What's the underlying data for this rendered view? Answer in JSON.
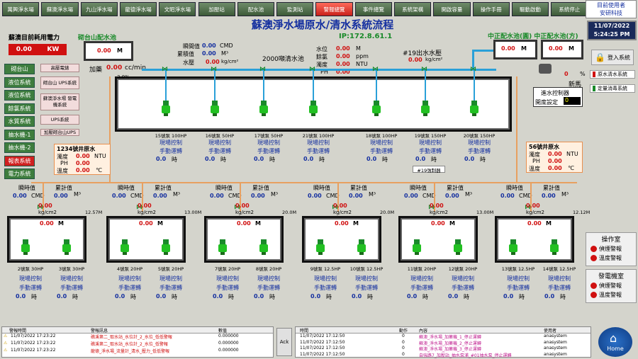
{
  "tabs": [
    {
      "label": "萬興淨水場",
      "active": false
    },
    {
      "label": "蘇澳淨水場",
      "active": false
    },
    {
      "label": "九山淨水場",
      "active": false
    },
    {
      "label": "龍德淨水場",
      "active": false
    },
    {
      "label": "文昭淨水場",
      "active": false
    },
    {
      "label": "加壓站",
      "active": false
    },
    {
      "label": "配水池",
      "active": false
    },
    {
      "label": "監測站",
      "active": false
    },
    {
      "label": "警報總覽",
      "active": true
    },
    {
      "label": "事件總覽",
      "active": false
    },
    {
      "label": "系統架構",
      "active": false
    },
    {
      "label": "開啟容量",
      "active": false
    },
    {
      "label": "操作手冊",
      "active": false
    },
    {
      "label": "驅動啟動",
      "active": false
    },
    {
      "label": "系統停止",
      "active": false
    }
  ],
  "user": {
    "label": "目前使用者",
    "name": "安研科技"
  },
  "clock": {
    "date": "11/07/2022",
    "time": "5:24:25 PM"
  },
  "title": "蘇澳淨水場原水/清水系統流程",
  "ip": "IP:172.8.61.1",
  "power": {
    "label": "蘇澳目前耗用電力",
    "value": "0.00",
    "unit": "KW"
  },
  "sidebar": [
    "砌台山",
    "液位系統",
    "液位系統",
    "餘氯系統",
    "水質系統",
    "抽水機-1",
    "抽水機-2",
    "報表系統",
    "電力系統"
  ],
  "pink_buttons": [
    "高壓電錶",
    "砌台山 UPS系統",
    "蘇澳淨水場 發電機系統",
    "UPS系統",
    "加壓砌台山UPS"
  ],
  "top_tank_label": "砌台山配水池",
  "top_tank_value": "0.00",
  "top_tank_unit": "M",
  "top_meter": {
    "run_label": "瞬間值",
    "total_label": "累積值",
    "press_label": "水壓",
    "run": "0.00",
    "run_unit": "CMD",
    "total": "0.00",
    "total_unit": "M³",
    "press": "0.00",
    "press_unit": "kg/cm²"
  },
  "dose": {
    "label": "加藥",
    "value": "0.00",
    "unit": "cc/min"
  },
  "pool": {
    "label": "2000噸清水池",
    "water_level_label": "水位",
    "chlorine_label": "餘氯",
    "turbidity_label": "濁度",
    "ph_label": "PH",
    "water_level": "0.00",
    "water_level_unit": "M",
    "chlorine": "0.00",
    "chlorine_unit": "ppm",
    "turbidity": "0.00",
    "turbidity_unit": "NTU",
    "ph": "0.00"
  },
  "outlet": {
    "label": "#19出水水壓",
    "value": "0.00",
    "unit": "kg/cm²"
  },
  "pct_label": "3.0%",
  "right_tanks": {
    "label": "中正配水池(圓) 中正配水池(方)",
    "left": "0.00",
    "right": "0.00",
    "unit": "M"
  },
  "water_control": {
    "label": "進水控制器",
    "set_label": "開度設定",
    "set_value": "0",
    "pct": "0",
    "unit": "%",
    "new_label": "新馬"
  },
  "right_buttons": [
    {
      "label": "登入系統"
    },
    {
      "label": "原水清水系統"
    },
    {
      "label": "定量消毒系統"
    }
  ],
  "top_pumps": [
    {
      "name": "15號泵 100HP",
      "ctl": "現場控制",
      "mode": "手動運轉",
      "val": "0.0",
      "unit": "時"
    },
    {
      "name": "16號泵 50HP",
      "ctl": "現場控制",
      "mode": "手動運轉",
      "val": "0.0",
      "unit": "時"
    },
    {
      "name": "17號泵 50HP",
      "ctl": "現場控制",
      "mode": "手動運轉",
      "val": "0.0",
      "unit": "時"
    },
    {
      "name": "21號泵 100HP",
      "ctl": "現場控制",
      "mode": "手動運轉",
      "val": "0.0",
      "unit": "時"
    },
    {
      "name": "18號泵 100HP",
      "ctl": "現場控制",
      "mode": "手動運轉",
      "val": "0.0",
      "unit": "時"
    },
    {
      "name": "19號泵 150HP",
      "ctl": "現場控制",
      "mode": "手動運轉",
      "val": "0.0",
      "unit": "時"
    },
    {
      "name": "20號泵 150HP",
      "ctl": "現場控制",
      "mode": "手動運轉",
      "val": "0.0",
      "unit": "時"
    }
  ],
  "alarm19": "#19強制器",
  "well1234": {
    "label": "1234號井原水",
    "turb_label": "濁度",
    "ph_label": "PH",
    "temp_label": "溫度",
    "turb": "0.00",
    "turb_unit": "NTU",
    "ph": "0.00",
    "temp": "0.00",
    "temp_unit": "℃"
  },
  "well56": {
    "label": "56號井原水",
    "turb_label": "濁度",
    "ph_label": "PH",
    "temp_label": "溫度",
    "turb": "0.00",
    "turb_unit": "NTU",
    "ph": "0.00",
    "temp": "0.00",
    "temp_unit": "℃"
  },
  "well_meters": [
    {
      "run_label": "瞬時值",
      "total_label": "累計值",
      "run": "0.00",
      "run_unit": "CMD",
      "total": "0.00",
      "total_unit": "M³",
      "press": "0.00",
      "press_unit": "kg/cm2",
      "level": "0.00",
      "level_unit": "M",
      "depth": "12.57M"
    },
    {
      "run_label": "瞬時值",
      "total_label": "累計值",
      "run": "0.00",
      "run_unit": "CMD",
      "total": "0.00",
      "total_unit": "M³",
      "press": "0.00",
      "press_unit": "kg/cm2",
      "level": "0.00",
      "level_unit": "M",
      "depth": "13.00M"
    },
    {
      "run_label": "瞬時值",
      "total_label": "累計值",
      "run": "0.00",
      "run_unit": "CMD",
      "total": "0.00",
      "total_unit": "M³",
      "press": "0.00",
      "press_unit": "kg/cm2",
      "level": "0.00",
      "level_unit": "M",
      "depth": "20.0M"
    },
    {
      "run_label": "瞬時值",
      "total_label": "累計值",
      "run": "0.00",
      "run_unit": "CMD",
      "total": "0.00",
      "total_unit": "M³",
      "press": "0.00",
      "press_unit": "kg/cm2",
      "level": "0.00",
      "level_unit": "M",
      "depth": "20.0M"
    },
    {
      "run_label": "瞬時值",
      "total_label": "累計值",
      "run": "0.00",
      "run_unit": "CMD",
      "total": "0.00",
      "total_unit": "M³",
      "press": "0.00",
      "press_unit": "kg/cm2",
      "level": "0.00",
      "level_unit": "M",
      "depth": "13.00M"
    },
    {
      "run_label": "瞬時值",
      "total_label": "累計值",
      "run": "0.00",
      "run_unit": "CMD",
      "total": "0.00",
      "total_unit": "M³",
      "press": "0.00",
      "press_unit": "kg/cm2",
      "level": "0.00",
      "level_unit": "M",
      "depth": "12.12M"
    }
  ],
  "well_pumps": [
    {
      "name": "2號泵 30HP",
      "ctl": "現場控制",
      "mode": "手動運轉",
      "val": "0.0",
      "unit": "時"
    },
    {
      "name": "3號泵 30HP",
      "ctl": "現場控制",
      "mode": "手動運轉",
      "val": "0.0",
      "unit": "時"
    },
    {
      "name": "4號泵 20HP",
      "ctl": "現場控制",
      "mode": "手動運轉",
      "val": "0.0",
      "unit": "時"
    },
    {
      "name": "5號泵 20HP",
      "ctl": "現場控制",
      "mode": "手動運轉",
      "val": "0.0",
      "unit": "時"
    },
    {
      "name": "7號泵 20HP",
      "ctl": "現場控制",
      "mode": "手動運轉",
      "val": "0.0",
      "unit": "時"
    },
    {
      "name": "8號泵 20HP",
      "ctl": "現場控制",
      "mode": "手動運轉",
      "val": "0.0",
      "unit": "時"
    },
    {
      "name": "9號泵 12.5HP",
      "ctl": "現場控制",
      "mode": "手動運轉",
      "val": "0.0",
      "unit": "時"
    },
    {
      "name": "10號泵 12.5HP",
      "ctl": "現場控制",
      "mode": "手動運轉",
      "val": "0.0",
      "unit": "時"
    },
    {
      "name": "11號泵 20HP",
      "ctl": "現場控制",
      "mode": "手動運轉",
      "val": "0.0",
      "unit": "時"
    },
    {
      "name": "12號泵 20HP",
      "ctl": "現場控制",
      "mode": "手動運轉",
      "val": "0.0",
      "unit": "時"
    },
    {
      "name": "13號泵 12.5HP",
      "ctl": "現場控制",
      "mode": "手動運轉",
      "val": "0.0",
      "unit": "時"
    },
    {
      "name": "14號泵 12.5HP",
      "ctl": "現場控制",
      "mode": "手動運轉",
      "val": "0.0",
      "unit": "時"
    }
  ],
  "ops_room": {
    "label": "操作室",
    "items": [
      "偵煙警報",
      "溫度警報"
    ]
  },
  "gen_room": {
    "label": "發電機室",
    "items": [
      "偵煙警報",
      "溫度警報"
    ]
  },
  "alarm_table": {
    "headers": [
      "警報時間",
      "警報訊息",
      "數值"
    ],
    "rows": [
      {
        "time": "11/07/2022 17:23:22",
        "msg": "礁溪第二_取水站_水位計_2_水位_低低警報",
        "val": "0.000000"
      },
      {
        "time": "11/07/2022 17:23:22",
        "msg": "礁溪第二_取水站_水位計_2_水位_低警報",
        "val": "0.000000"
      },
      {
        "time": "11/07/2022 17:23:22",
        "msg": "龍德_淨水場_流量計_清水_壓力_低低警報",
        "val": "0.000000"
      }
    ],
    "ack": "Ack"
  },
  "event_table": {
    "headers": [
      "時間",
      "動作",
      "內容",
      "使用者"
    ],
    "rows": [
      {
        "time": "11/07/2022 17:12:50",
        "act": "0",
        "msg": "蘇澳_淨水場_加藥機_1_停止運轉",
        "user": "anasystem"
      },
      {
        "time": "11/07/2022 17:12:50",
        "act": "0",
        "msg": "蘇澳_淨水場_加藥機_2_停止運轉",
        "user": "anasystem"
      },
      {
        "time": "11/07/2022 17:12:50",
        "act": "0",
        "msg": "蘇澳_淨水場_加藥機_3_停止運轉",
        "user": "anasystem"
      },
      {
        "time": "11/07/2022 17:12:50",
        "act": "0",
        "msg": "自強路7_加壓站_抽水泵浦_#01抽水泵_停止運轉",
        "user": "anasystem"
      }
    ]
  },
  "home": "Home"
}
